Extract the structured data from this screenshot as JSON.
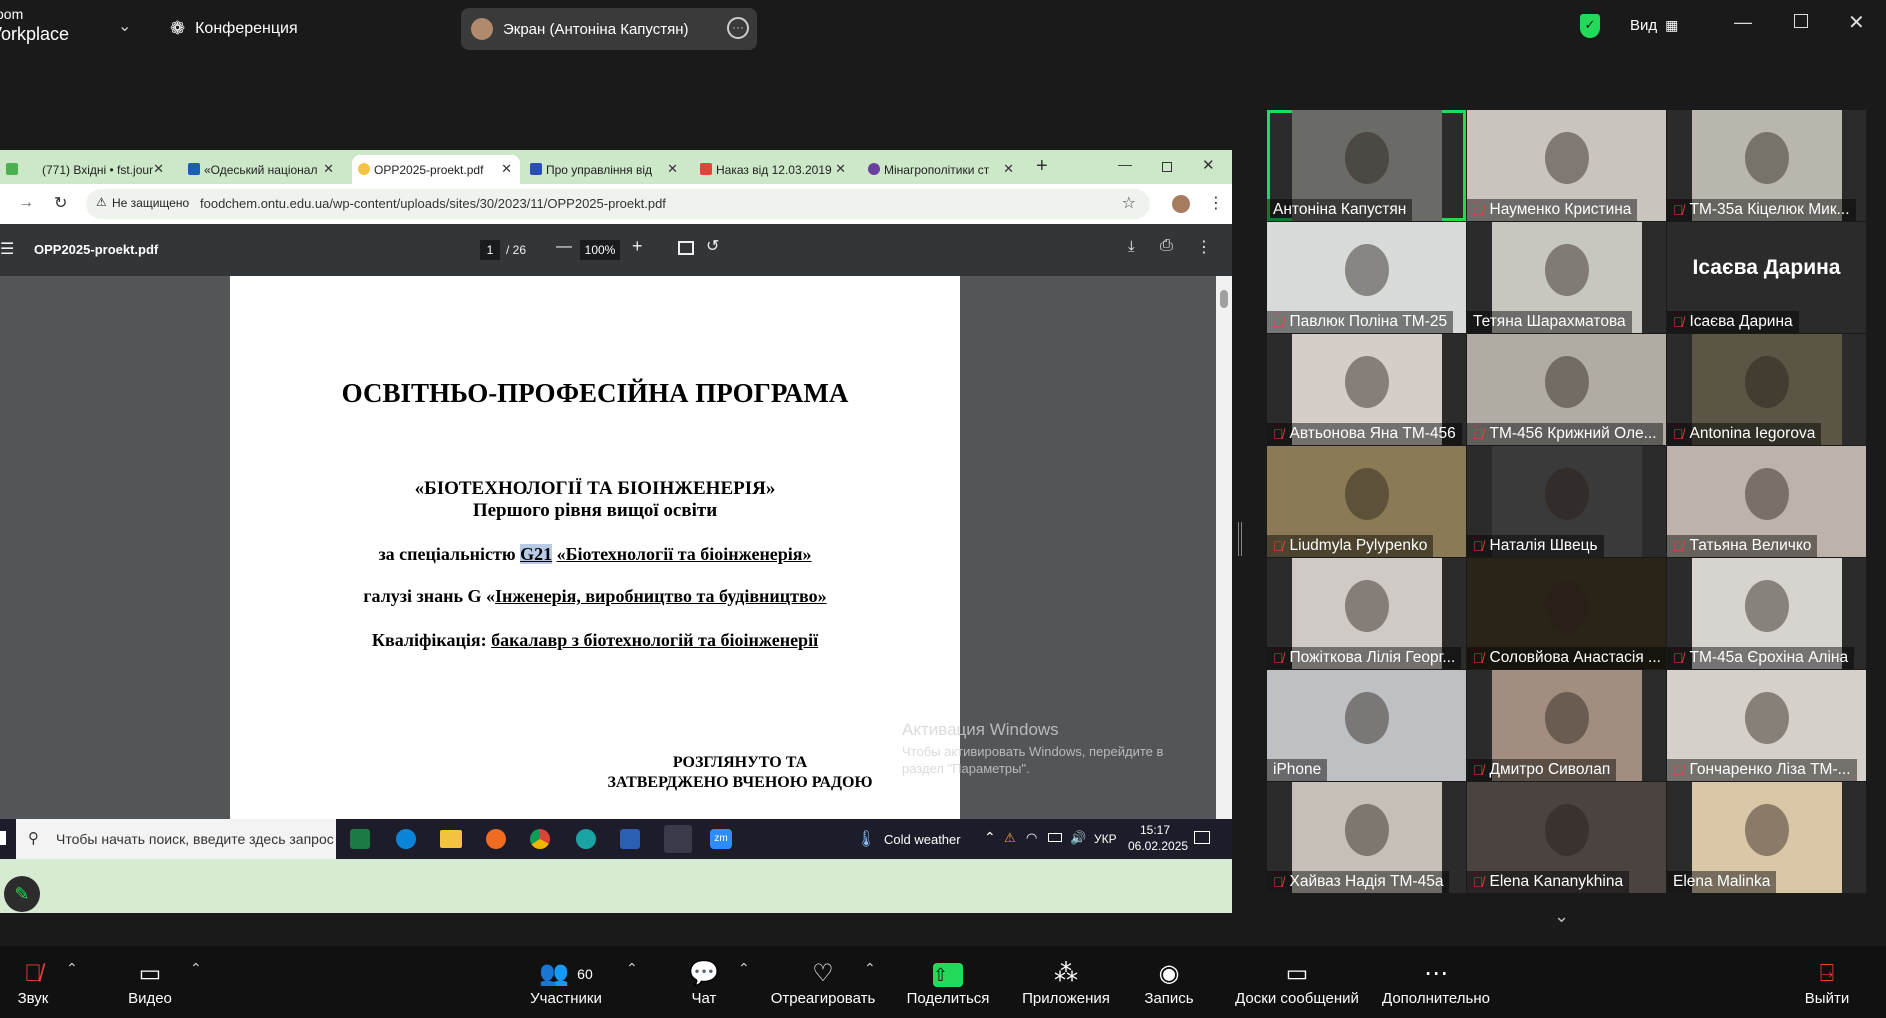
{
  "app": {
    "logo_line1": "oom",
    "logo_line2": "Vorkplace",
    "meeting_menu": "Конференция",
    "screen_share_label": "Экран (Антоніна Капустян)",
    "view_label": "Вид",
    "shield_color": "#23d959"
  },
  "browser": {
    "tabs": [
      {
        "label": "(771) Вхідні • fst.jour",
        "icon_color": "#4caf50"
      },
      {
        "label": "«Одеський націонал",
        "icon_color": "#1a5fb4"
      },
      {
        "label": "OPP2025-proekt.pdf",
        "icon_color": "#f6c445"
      },
      {
        "label": "Про управління від",
        "icon_color": "#2a4fb4"
      },
      {
        "label": "Наказ від 12.03.2019",
        "icon_color": "#e0443a"
      },
      {
        "label": "Мінагрополітики ст",
        "icon_color": "#6b3fa0"
      }
    ],
    "new_tab": "+",
    "security_label": "Не защищено",
    "url": "foodchem.ontu.edu.ua/wp-content/uploads/sites/30/2023/11/OPP2025-proekt.pdf"
  },
  "pdf": {
    "filename": "OPP2025-proekt.pdf",
    "page_current": "1",
    "page_total": "/ 26",
    "zoom": "100%",
    "lines": {
      "title": "ОСВІТНЬО-ПРОФЕСІЙНА ПРОГРАМА",
      "program": "«БІОТЕХНОЛОГІЇ ТА БІОІНЖЕНЕРІЯ»",
      "level": "Першого рівня вищої освіти",
      "specialty_prefix": "за спеціальністю",
      "specialty_code": "G21",
      "specialty_name": "«Біотехнології та біоінженерія»",
      "field_prefix": "галузі знань G «",
      "field_name": "Інженерія, виробництво та будівництво»",
      "qual_prefix": "Кваліфікація:",
      "qual_value": "бакалавр з біотехнологій та біоінженерії",
      "approved1": "РОЗГЛЯНУТО ТА",
      "approved2": "ЗАТВЕРДЖЕНО ВЧЕНОЮ РАДОЮ"
    },
    "watermark_title": "Активация Windows",
    "watermark_line1": "Чтобы активировать Windows, перейдите в",
    "watermark_line2": "раздел \"Параметры\"."
  },
  "windows_taskbar": {
    "search_placeholder": "Чтобы начать поиск, введите здесь запрос",
    "weather": "Cold weather",
    "lang": "УКР",
    "time": "15:17",
    "date": "06.02.2025"
  },
  "participants": [
    {
      "name": "Антоніна Капустян",
      "muted": false,
      "speaking": true,
      "bg": "#6a6a66"
    },
    {
      "name": "Науменко Кристина",
      "muted": true,
      "bg": "#c9c4be"
    },
    {
      "name": "ТМ-35а Кіцелюк Мик...",
      "muted": true,
      "bg": "#b9b6ae"
    },
    {
      "name": "Павлюк Поліна ТМ-25",
      "muted": true,
      "bg": "#d8dbd9"
    },
    {
      "name": "Тетяна Шарахматова",
      "muted": false,
      "bg": "#c8c7bf"
    },
    {
      "name": "Ісаєва Дарина",
      "muted": true,
      "bg": "#2b2b2b",
      "avatar_text": "Ісаєва Дарина"
    },
    {
      "name": "Автьонова Яна ТМ-456",
      "muted": true,
      "bg": "#d4cdc8"
    },
    {
      "name": "ТМ-456 Крижний Оле...",
      "muted": true,
      "bg": "#b0aca4"
    },
    {
      "name": "Antonina Iegorova",
      "muted": true,
      "bg": "#5a5545"
    },
    {
      "name": "Liudmyla Pylypenko",
      "muted": true,
      "bg": "#8a7a55"
    },
    {
      "name": "Наталія Швець",
      "muted": true,
      "bg": "#3b3a3a"
    },
    {
      "name": "Татьяна Величко",
      "muted": true,
      "bg": "#bdb3aa"
    },
    {
      "name": "Пожіткова Лілія Георг...",
      "muted": true,
      "bg": "#cfcac6"
    },
    {
      "name": "Соловйова Анастасія ...",
      "muted": true,
      "bg": "#2a2418"
    },
    {
      "name": "ТМ-45а Єрохіна Аліна",
      "muted": true,
      "bg": "#d7d3cf"
    },
    {
      "name": "iPhone",
      "muted": false,
      "bg": "#bfc0c3"
    },
    {
      "name": "Дмитро Сиволап",
      "muted": true,
      "bg": "#a28e80"
    },
    {
      "name": "Гончаренко Ліза ТМ-...",
      "muted": true,
      "bg": "#d5d0c9"
    },
    {
      "name": "Хайваз Надія ТМ-45а",
      "muted": true,
      "bg": "#c5bfb7"
    },
    {
      "name": "Elena Kananykhina",
      "muted": true,
      "bg": "#4a4340"
    },
    {
      "name": "Elena Malinka",
      "muted": false,
      "bg": "#d9c7a8"
    }
  ],
  "toolbar": {
    "audio": "Звук",
    "video": "Видео",
    "participants": "Участники",
    "participants_count": "60",
    "chat": "Чат",
    "react": "Отреагировать",
    "share": "Поделиться",
    "apps": "Приложения",
    "record": "Запись",
    "whiteboards": "Доски сообщений",
    "more": "Дополнительно",
    "leave": "Выйти",
    "share_color": "#23d959"
  }
}
